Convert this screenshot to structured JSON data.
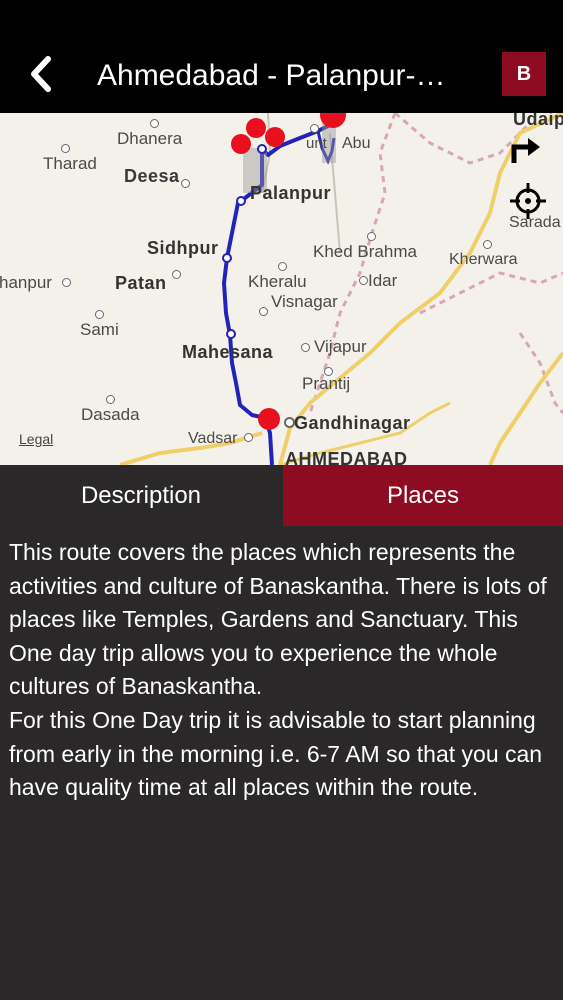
{
  "header": {
    "title": "Ahmedabad - Palanpur-…",
    "b_label": "B"
  },
  "map": {
    "legal": "Legal",
    "places": {
      "dhanera": "Dhanera",
      "tharad": "Tharad",
      "deesa": "Deesa",
      "palanpur": "Palanpur",
      "abu": "Abu",
      "mount": "unt",
      "udaipur": "Udaip",
      "sarada": "Sarada",
      "sidhpur": "Sidhpur",
      "khed_brahma": "Khed Brahma",
      "kherwara": "Kherwara",
      "radhanpur": "hanpur",
      "patan": "Patan",
      "kheralu": "Kheralu",
      "idar": "Idar",
      "visnagar": "Visnagar",
      "sami": "Sami",
      "mahesana": "Mahesana",
      "vijapur": "Vijapur",
      "prantij": "Prantij",
      "dasada": "Dasada",
      "gandhinagar": "Gandhinagar",
      "vadsar": "Vadsar",
      "ahmedabad": "AHMEDABAD"
    },
    "icons": {
      "turn": "turn-arrow-icon",
      "locate": "crosshair-location-icon"
    },
    "colors": {
      "route": "#2323b8",
      "pin": "#e8101f",
      "land": "#f4f1ea",
      "highway": "#f2d26b"
    }
  },
  "tabs": {
    "description": "Description",
    "places": "Places",
    "active": "Places"
  },
  "description": {
    "paragraph1": "This route covers the places which represents the activities and culture of Banaskantha. There is lots of places like Temples, Gardens and Sanctuary. This One day trip allows you to experience the whole cultures of Banaskantha.",
    "paragraph2": "For this One Day trip it is advisable to start planning from early in the morning i.e. 6-7 AM so that you can have quality time at all places within the route."
  },
  "colors": {
    "header_bg": "#000000",
    "accent": "#8e0c21",
    "body_bg": "#2a2829",
    "text": "#ffffff"
  }
}
